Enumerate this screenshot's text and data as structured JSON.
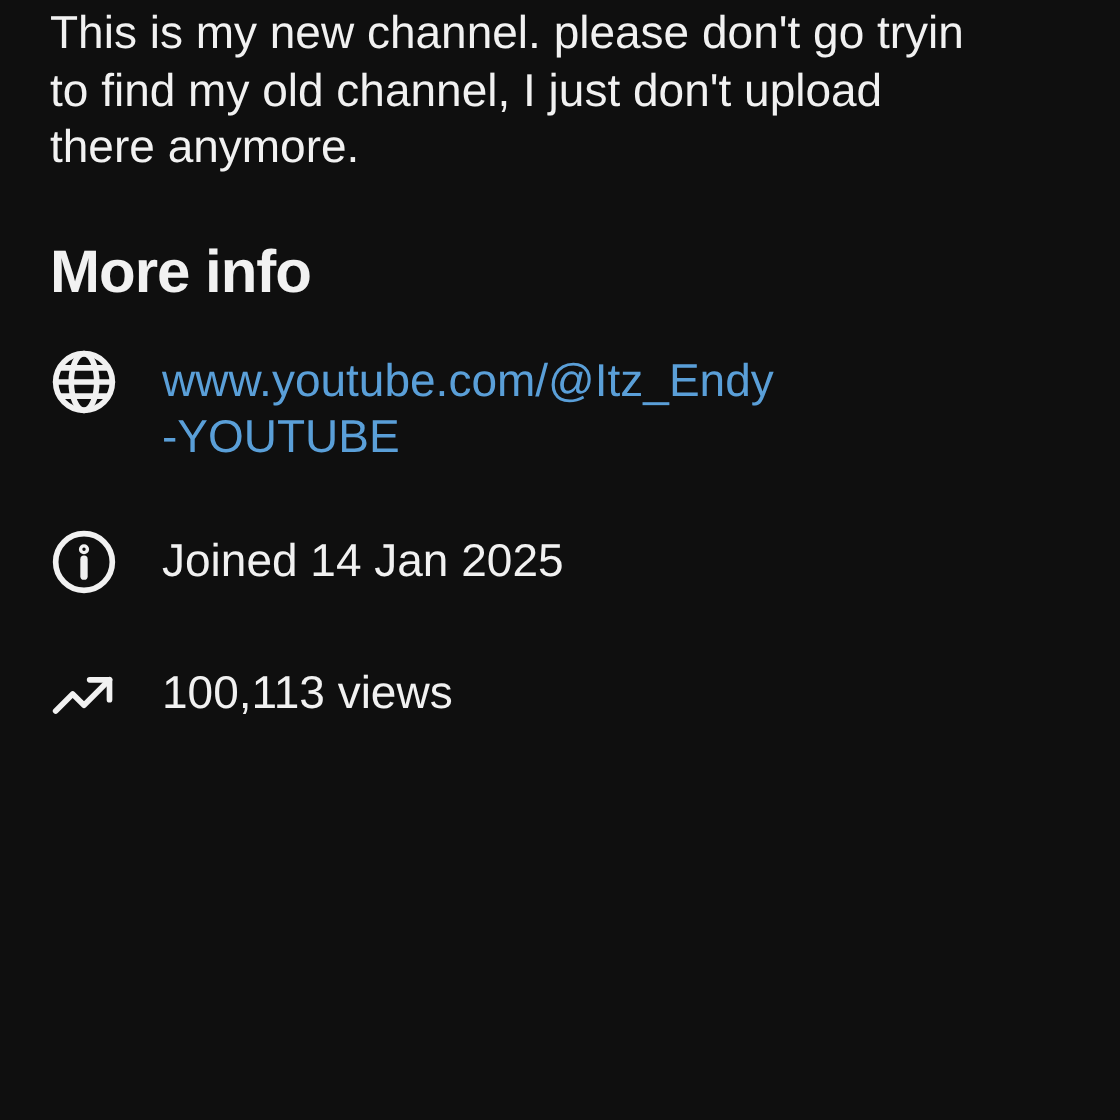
{
  "description": {
    "lines": [
      "This is my new channel. please don't go tryin",
      "to find my old channel, I just don't upload",
      "there anymore."
    ]
  },
  "more_info": {
    "title": "More info",
    "items": [
      {
        "kind": "link",
        "lines": [
          "www.youtube.com/@Itz_Endy",
          "-YOUTUBE"
        ]
      },
      {
        "kind": "joined",
        "text": "Joined 14 Jan 2025"
      },
      {
        "kind": "views",
        "text": "100,113 views"
      }
    ]
  }
}
